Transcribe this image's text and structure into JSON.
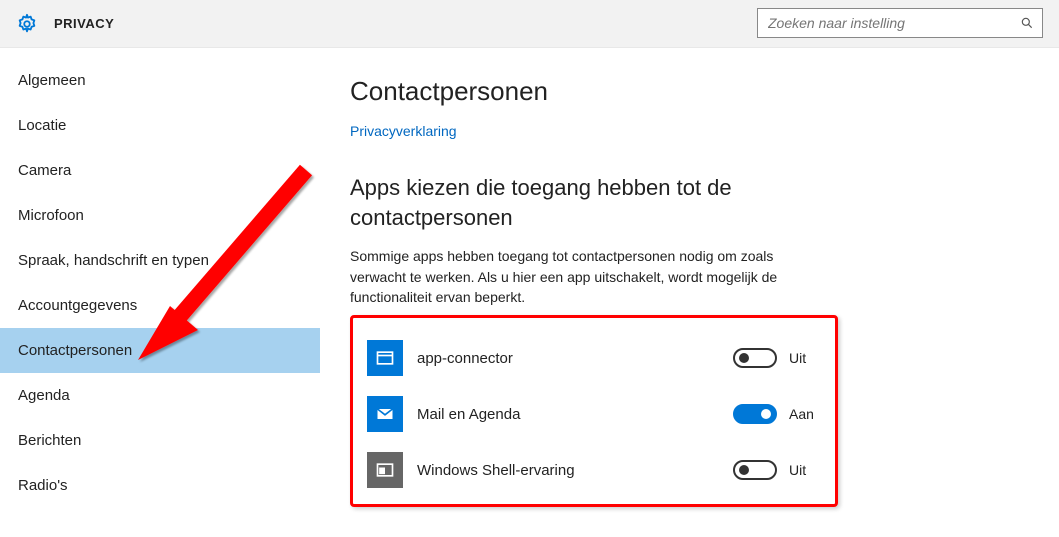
{
  "header": {
    "title": "PRIVACY",
    "search_placeholder": "Zoeken naar instelling"
  },
  "sidebar": {
    "items": [
      {
        "label": "Algemeen"
      },
      {
        "label": "Locatie"
      },
      {
        "label": "Camera"
      },
      {
        "label": "Microfoon"
      },
      {
        "label": "Spraak, handschrift en typen"
      },
      {
        "label": "Accountgegevens"
      },
      {
        "label": "Contactpersonen",
        "selected": true
      },
      {
        "label": "Agenda"
      },
      {
        "label": "Berichten"
      },
      {
        "label": "Radio's"
      }
    ]
  },
  "main": {
    "h1": "Contactpersonen",
    "privacy_link": "Privacyverklaring",
    "h2": "Apps kiezen die toegang hebben tot de contactpersonen",
    "desc": "Sommige apps hebben toegang tot contactpersonen nodig om zoals verwacht te werken. Als u hier een app uitschakelt, wordt mogelijk de functionaliteit ervan beperkt.",
    "apps": [
      {
        "name": "app-connector",
        "state": false,
        "state_label": "Uit",
        "icon": "window",
        "iconBg": "blue"
      },
      {
        "name": "Mail en Agenda",
        "state": true,
        "state_label": "Aan",
        "icon": "mail",
        "iconBg": "blue"
      },
      {
        "name": "Windows Shell-ervaring",
        "state": false,
        "state_label": "Uit",
        "icon": "shell",
        "iconBg": "dark"
      }
    ]
  }
}
